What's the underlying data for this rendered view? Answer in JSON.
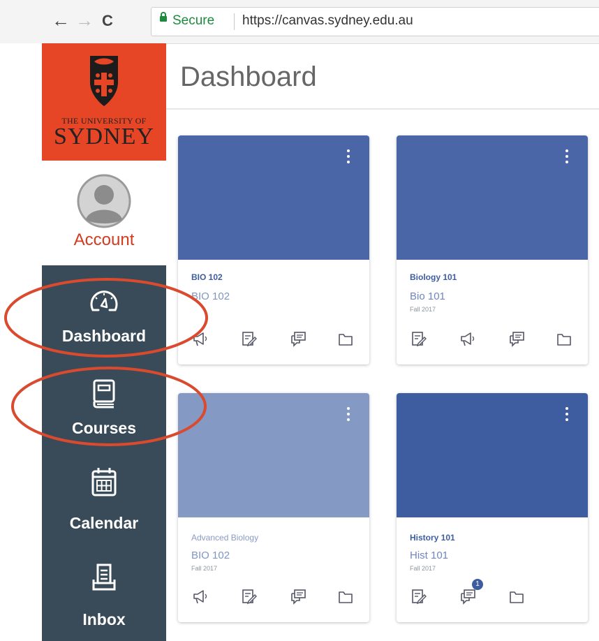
{
  "browser": {
    "back": "←",
    "forward": "→",
    "reload": "C",
    "secure_label": "Secure",
    "url": "https://canvas.sydney.edu.au"
  },
  "sidebar": {
    "logo_line1": "THE UNIVERSITY OF",
    "logo_line2": "SYDNEY",
    "brand_color": "#e64626",
    "nav_bg": "#394b58",
    "items": [
      {
        "label": "Account",
        "icon": "avatar-icon"
      },
      {
        "label": "Dashboard",
        "icon": "dashboard-gauge-icon"
      },
      {
        "label": "Courses",
        "icon": "book-icon"
      },
      {
        "label": "Calendar",
        "icon": "calendar-icon"
      },
      {
        "label": "Inbox",
        "icon": "inbox-icon"
      }
    ]
  },
  "main": {
    "title": "Dashboard"
  },
  "courses": [
    {
      "name": "BIO 102",
      "code": "BIO 102",
      "term": "",
      "color": "#4a66a6",
      "icons": [
        "announcement-icon",
        "assignment-icon",
        "discussion-icon",
        "files-icon"
      ]
    },
    {
      "name": "Biology 101",
      "code": "Bio 101",
      "term": "Fall 2017",
      "color": "#4a66a6",
      "icons": [
        "assignment-icon",
        "announcement-icon",
        "discussion-icon",
        "files-icon"
      ]
    },
    {
      "name": "Advanced Biology",
      "code": "BIO 102",
      "term": "Fall 2017",
      "color": "#8599c5",
      "icons": [
        "announcement-icon",
        "assignment-icon",
        "discussion-icon",
        "files-icon"
      ]
    },
    {
      "name": "History 101",
      "code": "Hist 101",
      "term": "Fall 2017",
      "color": "#3e5da0",
      "badge": "1",
      "icons": [
        "assignment-icon",
        "discussion-icon",
        "files-icon"
      ]
    }
  ],
  "annotation_color": "#d94a2e"
}
